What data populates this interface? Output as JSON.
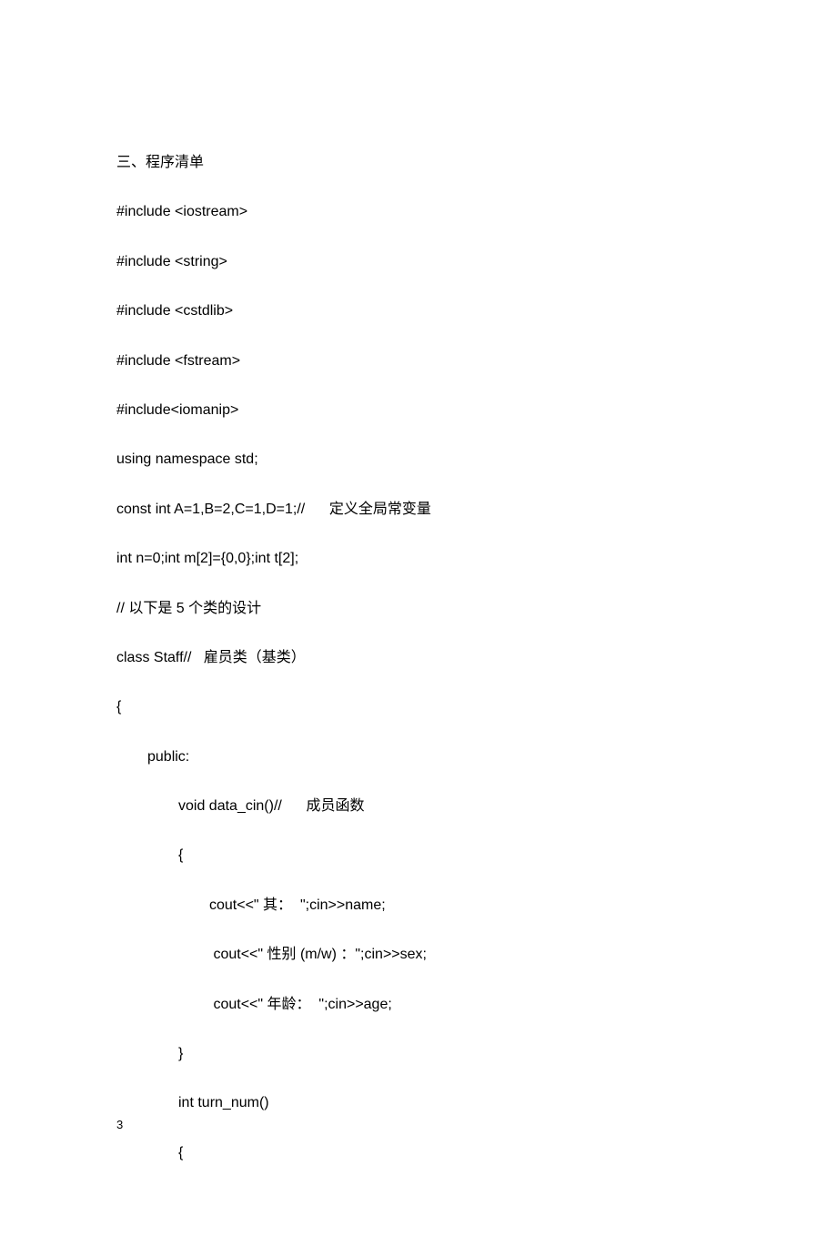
{
  "lines": [
    {
      "text": "三、程序清单",
      "indent": 0
    },
    {
      "text": "#include <iostream>",
      "indent": 0
    },
    {
      "text": "#include <string>",
      "indent": 0
    },
    {
      "text": "#include <cstdlib>",
      "indent": 0
    },
    {
      "text": "#include <fstream>",
      "indent": 0
    },
    {
      "text": "#include<iomanip>",
      "indent": 0
    },
    {
      "text": "using namespace std;",
      "indent": 0
    },
    {
      "text": "const int A=1,B=2,C=1,D=1;//      定义全局常变量",
      "indent": 0
    },
    {
      "text": "int n=0;int m[2]={0,0};int t[2];",
      "indent": 0
    },
    {
      "text": "// 以下是 5 个类的设计",
      "indent": 0
    },
    {
      "text": "class Staff//   雇员类（基类）",
      "indent": 0
    },
    {
      "text": "{",
      "indent": 0
    },
    {
      "text": "public:",
      "indent": 1
    },
    {
      "text": "void data_cin()//      成员函数",
      "indent": 2
    },
    {
      "text": "{",
      "indent": 2
    },
    {
      "text": "cout<<\" 其：  \";cin>>name;",
      "indent": 3
    },
    {
      "text": " cout<<\" 性别 (m/w) ：\";cin>>sex;",
      "indent": 3
    },
    {
      "text": " cout<<\" 年龄：  \";cin>>age;",
      "indent": 3
    },
    {
      "text": "}",
      "indent": 2
    },
    {
      "text": "int turn_num()",
      "indent": 2
    },
    {
      "text": "{",
      "indent": 2
    }
  ],
  "page_number": "3"
}
